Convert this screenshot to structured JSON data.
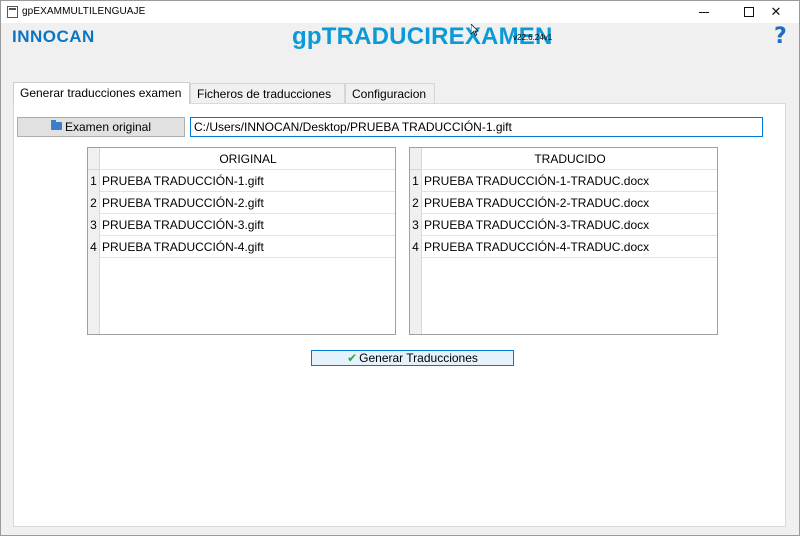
{
  "window": {
    "title": "gpEXAMMULTILENGUAJE",
    "controls": {
      "minimize": "",
      "maximize": "",
      "close": "✕"
    }
  },
  "header": {
    "logo": "INNOCAN",
    "app_name": "gpTRADUCIREXAMEN",
    "version": "v22.6.24v1",
    "help": "?"
  },
  "tabs": [
    {
      "label": "Generar traducciones examen",
      "active": true
    },
    {
      "label": "Ficheros de traducciones",
      "active": false
    },
    {
      "label": "Configuracion",
      "active": false
    }
  ],
  "toolbar": {
    "examen_button_label": "Examen original",
    "path_value": "C:/Users/INNOCAN/Desktop/PRUEBA TRADUCCIÓN-1.gift"
  },
  "original_table": {
    "header": "ORIGINAL",
    "rows": [
      {
        "num": "1",
        "value": "PRUEBA TRADUCCIÓN-1.gift"
      },
      {
        "num": "2",
        "value": "PRUEBA TRADUCCIÓN-2.gift"
      },
      {
        "num": "3",
        "value": "PRUEBA TRADUCCIÓN-3.gift"
      },
      {
        "num": "4",
        "value": "PRUEBA TRADUCCIÓN-4.gift"
      }
    ]
  },
  "translated_table": {
    "header": "TRADUCIDO",
    "rows": [
      {
        "num": "1",
        "value": "PRUEBA TRADUCCIÓN-1-TRADUC.docx"
      },
      {
        "num": "2",
        "value": "PRUEBA TRADUCCIÓN-2-TRADUC.docx"
      },
      {
        "num": "3",
        "value": "PRUEBA TRADUCCIÓN-3-TRADUC.docx"
      },
      {
        "num": "4",
        "value": "PRUEBA TRADUCCIÓN-4-TRADUC.docx"
      }
    ]
  },
  "actions": {
    "generate_label": "Generar Traducciones"
  },
  "colors": {
    "brand": "#0b9ad7",
    "logo": "#0a76c2",
    "help": "#1e6fc4",
    "focus_border": "#0078d7",
    "check": "#2aa64a"
  },
  "icons": {
    "folder": "folder-icon",
    "check": "check-icon",
    "help": "help-icon"
  }
}
